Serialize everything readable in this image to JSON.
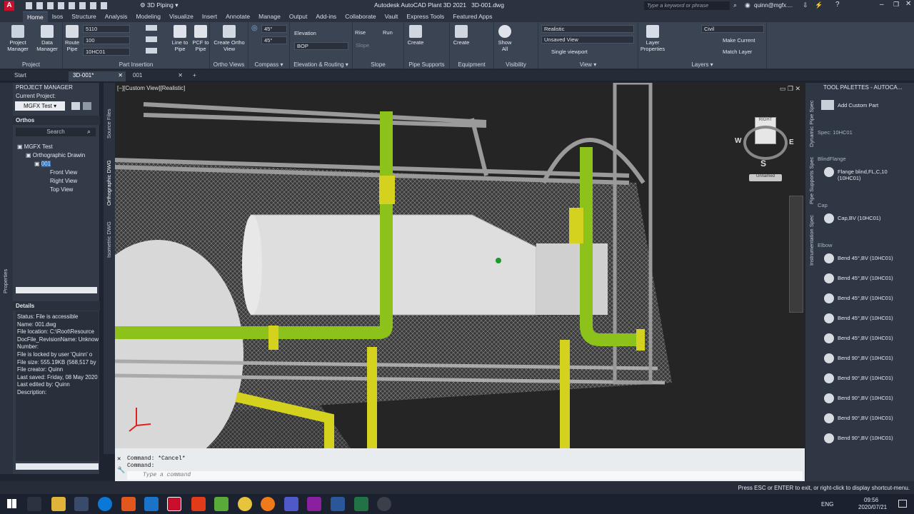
{
  "title_bar": {
    "workspace": "3D Piping",
    "app_title": "Autodesk AutoCAD Plant 3D 2021",
    "file": "3D-001.dwg",
    "search_placeholder": "Type a keyword or phrase",
    "user": "quinn@mgfx...."
  },
  "ribbon_tabs": [
    "Home",
    "Isos",
    "Structure",
    "Analysis",
    "Modeling",
    "Visualize",
    "Insert",
    "Annotate",
    "Manage",
    "Output",
    "Add-ins",
    "Collaborate",
    "Vault",
    "Express Tools",
    "Featured Apps"
  ],
  "ribbon": {
    "project": {
      "title": "Project",
      "btn1": "Project Manager",
      "btn2": "Data Manager"
    },
    "part_insertion": {
      "title": "Part Insertion",
      "route": "Route Pipe",
      "size": "5110",
      "size2": "100",
      "spec": "10HC01",
      "line": "Line to Pipe",
      "pcf": "PCF to Pipe"
    },
    "ortho": {
      "title": "Ortho Views",
      "btn": "Create Ortho View"
    },
    "compass": {
      "title": "Compass",
      "angle1": "45°",
      "angle2": "45°"
    },
    "elevation": {
      "title": "Elevation & Routing",
      "label": "Elevation",
      "bop": "BOP"
    },
    "slope": {
      "title": "Slope",
      "rise": "Rise",
      "run": "Run",
      "slope": "Slope"
    },
    "pipe_supports": {
      "title": "Pipe Supports",
      "btn": "Create"
    },
    "equipment": {
      "title": "Equipment",
      "btn": "Create"
    },
    "visibility": {
      "title": "Visibility",
      "btn": "Show All"
    },
    "view": {
      "title": "View",
      "style": "Realistic",
      "saved": "Unsaved View",
      "viewport": "Single viewport"
    },
    "layers": {
      "title": "Layers",
      "btn": "Layer Properties",
      "layer": "Civil",
      "make_current": "Make Current",
      "match_layer": "Match Layer"
    }
  },
  "doc_tabs": [
    "Start",
    "3D-001*",
    "001"
  ],
  "project_manager": {
    "header": "PROJECT MANAGER",
    "current_project_label": "Current Project:",
    "current_project": "MGFX Test",
    "section": "Orthos",
    "search": "Search",
    "tree": [
      "MGFX Test",
      "Orthographic Drawin",
      "001",
      "Front View",
      "Right View",
      "Top View"
    ],
    "details_header": "Details",
    "details": [
      "Status: File is accessible",
      "Name: 001.dwg",
      "File location: C:\\Root\\Resource",
      "DocFile_RevisionName: Unknow",
      "Number:",
      "File is locked by user 'Quinn' o",
      "File size: 555.19KB (568,517 by",
      "File creator: Quinn",
      "Last saved: Friday, 08 May 2020",
      "Last edited by: Quinn",
      "Description:"
    ]
  },
  "side_tabs": {
    "left": "Properties",
    "source": "Source Files",
    "ortho": "Orthographic DWG",
    "iso": "Isometric DWG"
  },
  "viewport": {
    "label": "[−][Custom View][Realistic]",
    "viewcube": "RIGHT",
    "compass_w": "W",
    "compass_e": "E",
    "compass_s": "S",
    "ucs": "Unnamed"
  },
  "command": {
    "line1": "Command: *Cancel*",
    "line2": "Command:",
    "placeholder": "Type a command"
  },
  "tool_palette": {
    "header": "TOOL PALETTES - AUTOCA...",
    "add_custom": "Add Custom Part",
    "spec": "Spec: 10HC01",
    "tabs": [
      "Dynamic Pipe Spec",
      "Pipe Supports Spec",
      "Instrumentation Spec"
    ],
    "groups": [
      {
        "name": "BlindFlange",
        "items": [
          "Flange blind,FL,C,10 (10HC01)"
        ]
      },
      {
        "name": "Cap",
        "items": [
          "Cap,BV (10HC01)"
        ]
      },
      {
        "name": "Elbow",
        "items": [
          "Bend 45°,BV (10HC01)",
          "Bend 45°,BV (10HC01)",
          "Bend 45°,BV (10HC01)",
          "Bend 45°,BV (10HC01)",
          "Bend 45°,BV (10HC01)",
          "Bend 90°,BV (10HC01)",
          "Bend 90°,BV (10HC01)",
          "Bend 90°,BV (10HC01)",
          "Bend 90°,BV (10HC01)",
          "Bend 90°,BV (10HC01)"
        ]
      }
    ]
  },
  "status_hint": "Press ESC or ENTER to exit, or right-click to display shortcut-menu.",
  "taskbar": {
    "lang": "ENG",
    "time": "09:56",
    "date": "2020/07/21"
  },
  "colors": {
    "pipe_green": "#8cc21a",
    "pipe_yellow": "#d4d21e",
    "ribbon_bg": "#3b4453"
  }
}
